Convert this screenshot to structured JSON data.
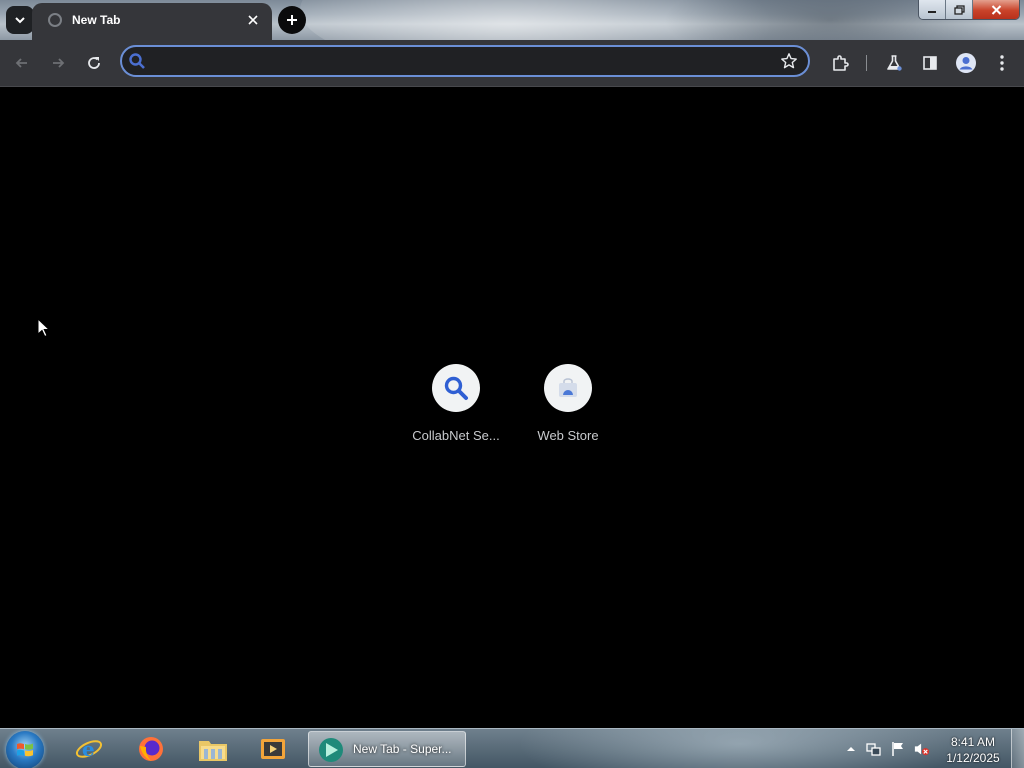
{
  "browser": {
    "tab": {
      "title": "New Tab"
    },
    "omnibox": {
      "value": "",
      "placeholder": ""
    }
  },
  "shortcuts": [
    {
      "label": "CollabNet Se...",
      "icon": "search-icon"
    },
    {
      "label": "Web Store",
      "icon": "web-store-icon"
    }
  ],
  "taskbar": {
    "active_task": {
      "label": "New Tab - Super..."
    },
    "pinned": [
      "internet-explorer-icon",
      "firefox-icon",
      "file-explorer-icon",
      "media-player-icon"
    ],
    "clock": {
      "time": "8:41 AM",
      "date": "1/12/2025"
    }
  },
  "colors": {
    "accent": "#6b8fd6",
    "toolbar": "#35363a",
    "content_bg": "#000000"
  }
}
